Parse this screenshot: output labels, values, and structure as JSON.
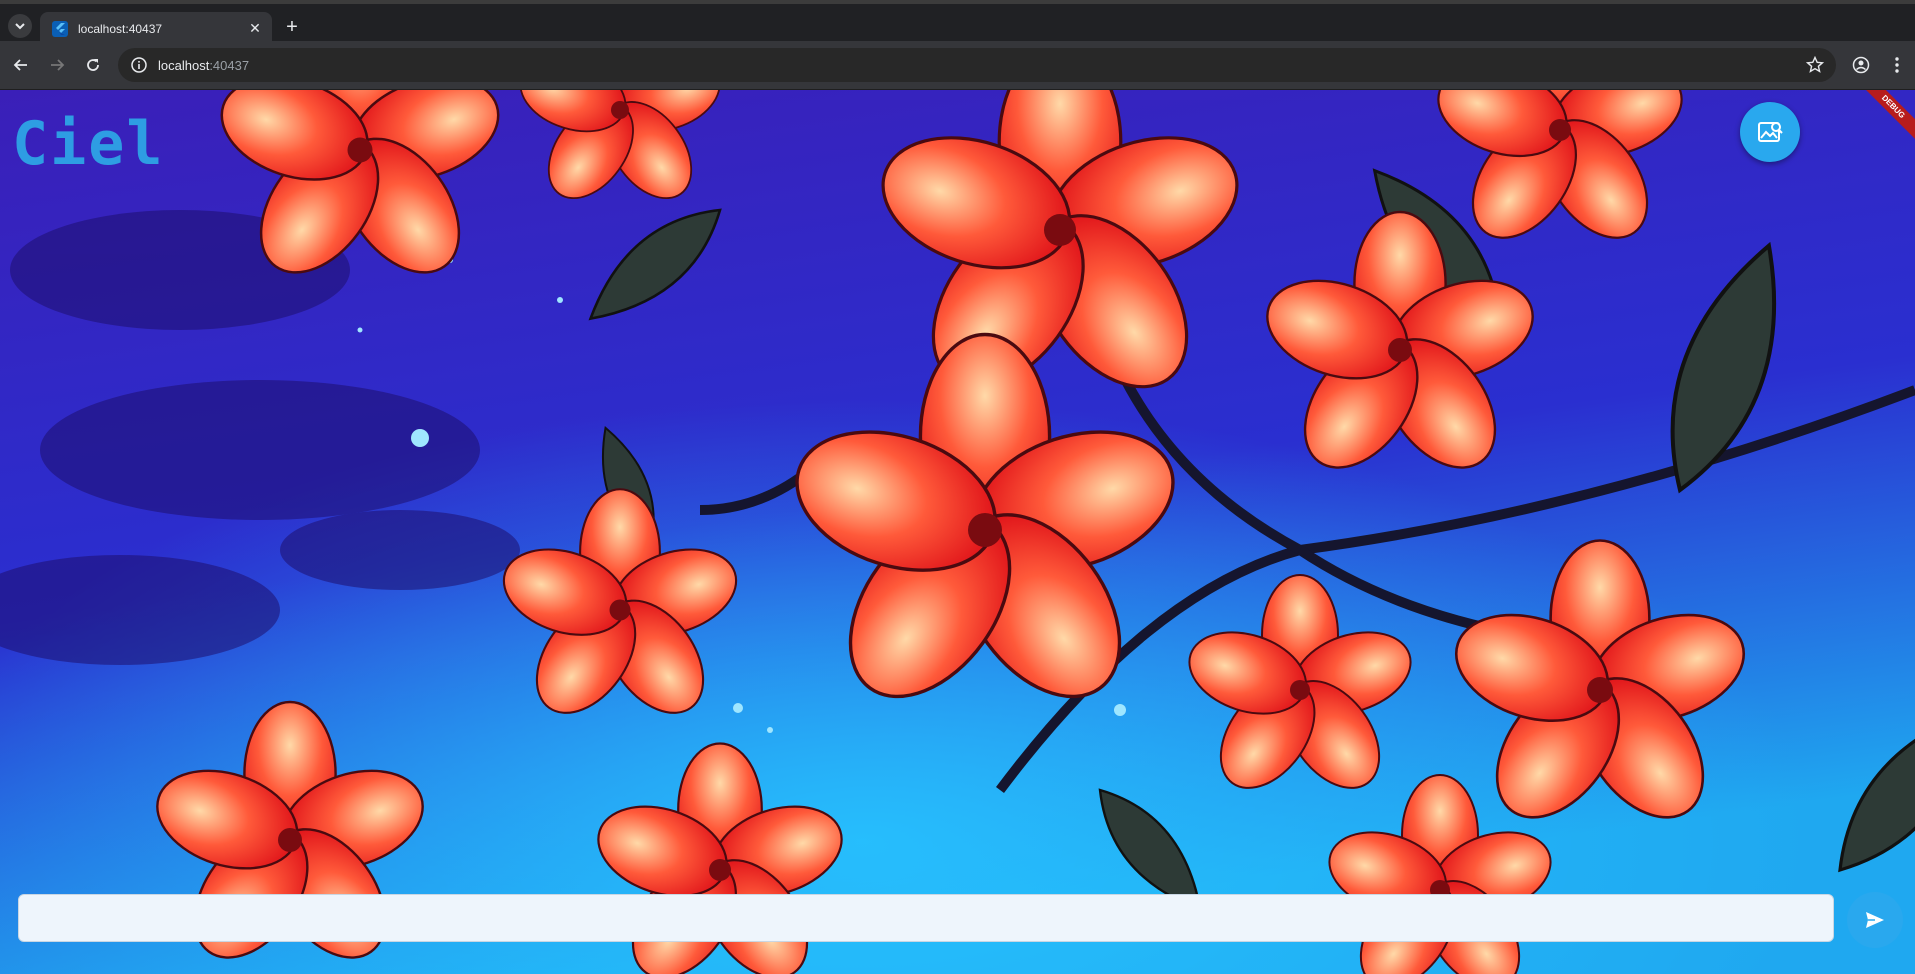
{
  "browser": {
    "tab_title": "localhost:40437",
    "address_host": "localhost",
    "address_port": ":40437"
  },
  "app": {
    "logo_text": "Ciel",
    "debug_label": "DEBUG",
    "chat_input_value": "",
    "accent_color": "#29a8ee",
    "logo_color": "#2e9de3"
  },
  "icons": {
    "gallery_button": "image-search-icon",
    "send_button": "send-icon"
  }
}
